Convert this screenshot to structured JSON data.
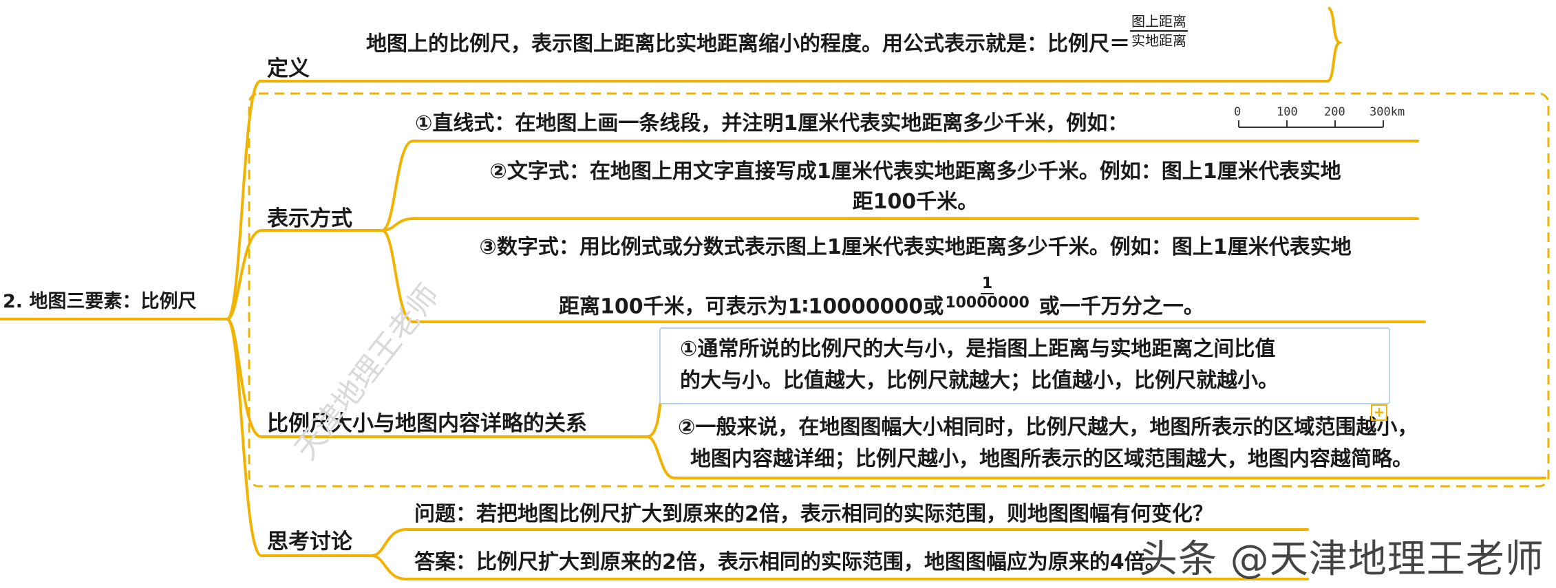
{
  "root": {
    "label": "2. 地图三要素：比例尺"
  },
  "definition": {
    "label": "定义",
    "text": "地图上的比例尺，表示图上距离比实地距离缩小的程度。用公式表示就是：比例尺＝",
    "frac_num": "图上距离",
    "frac_den": "实地距离"
  },
  "methods": {
    "label": "表示方式",
    "line1": "①直线式：在地图上画一条线段，并注明1厘米代表实地距离多少千米，例如：",
    "scale_ticks": [
      "0",
      "100",
      "200",
      "300km"
    ],
    "line2a": "②文字式：在地图上用文字直接写成1厘米代表实地距离多少千米。例如：图上1厘米代表实地",
    "line2b": "距100千米。",
    "line3a": "③数字式：用比例式或分数式表示图上1厘米代表实地距离多少千米。例如：图上1厘米代表实地",
    "line3b_pre": "距离100千米，可表示为1∶10000000或",
    "line3b_num": "1",
    "line3b_den": "10000000",
    "line3b_post": "或一千万分之一。"
  },
  "relation": {
    "label": "比例尺大小与地图内容详略的关系",
    "item1a": "①通常所说的比例尺的大与小，是指图上距离与实地距离之间比值",
    "item1b": "的大与小。比值越大，比例尺就越大；比值越小，比例尺就越小。",
    "item2a": "②一般来说，在地图图幅大小相同时，比例尺越大，地图所表示的区域范围越小，",
    "item2b": "地图内容越详细；比例尺越小，地图所表示的区域范围越大，地图内容越简略。",
    "expand_symbol": "+"
  },
  "discussion": {
    "label": "思考讨论",
    "question": "问题：若把地图比例尺扩大到原来的2倍，表示相同的实际范围，则地图图幅有何变化？",
    "answer": "答案：比例尺扩大到原来的2倍，表示相同的实际范围，地图图幅应为原来的4倍。"
  },
  "watermark": "天津地理王老师",
  "brand": "头条 @天津地理王老师",
  "colors": {
    "branch": "#f2b300",
    "box_border": "#b9d3ea",
    "text": "#1a1a1a"
  }
}
